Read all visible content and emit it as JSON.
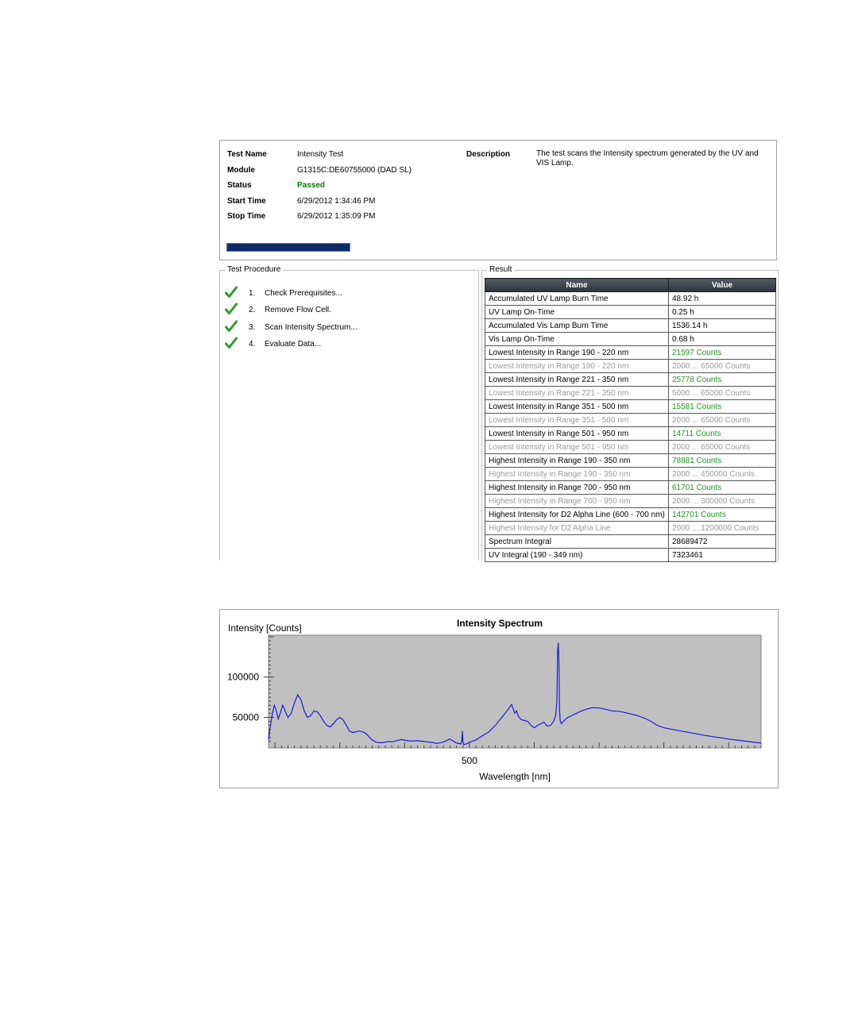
{
  "info": {
    "test_name_label": "Test Name",
    "test_name_value": "Intensity Test",
    "module_label": "Module",
    "module_value": "G1315C:DE60755000 (DAD SL)",
    "status_label": "Status",
    "status_value": "Passed",
    "start_label": "Start Time",
    "start_value": "6/29/2012 1:34:46 PM",
    "stop_label": "Stop Time",
    "stop_value": "6/29/2012 1:35:09 PM",
    "description_label": "Description",
    "description_value": "The test scans the Intensity spectrum generated by the UV and VIS Lamp.",
    "progress_percent": 100,
    "progress_color": "#0e2a6a"
  },
  "procedure": {
    "title": "Test Procedure",
    "steps": [
      {
        "num": "1.",
        "label": "Check Prerequisites...",
        "icon": "checkmark-icon"
      },
      {
        "num": "2.",
        "label": "Remove Flow Cell.",
        "icon": "checkmark-icon"
      },
      {
        "num": "3.",
        "label": "Scan Intensity Spectrum...",
        "icon": "checkmark-icon"
      },
      {
        "num": "4.",
        "label": "Evaluate Data...",
        "icon": "checkmark-icon"
      }
    ]
  },
  "result": {
    "title": "Result",
    "col_name": "Name",
    "col_value": "Value",
    "rows": [
      {
        "name": "Accumulated UV Lamp Burn Time",
        "value": "48.92 h",
        "type": "normal"
      },
      {
        "name": "UV Lamp On-Time",
        "value": "0.25 h",
        "type": "normal"
      },
      {
        "name": "Accumulated Vis Lamp Burn Time",
        "value": "1536.14 h",
        "type": "normal"
      },
      {
        "name": "Vis Lamp On-Time",
        "value": "0.68 h",
        "type": "normal"
      },
      {
        "name": "Lowest Intensity in Range 190 - 220 nm",
        "value": "21597 Counts",
        "type": "green"
      },
      {
        "name": "Lowest Intensity in Range 190 - 220 nm",
        "value": "2000 ... 65000 Counts",
        "type": "sub"
      },
      {
        "name": "Lowest Intensity in Range 221 - 350 nm",
        "value": "25778 Counts",
        "type": "green"
      },
      {
        "name": "Lowest Intensity in Range 221 - 350 nm",
        "value": "5000 ... 65000 Counts",
        "type": "sub"
      },
      {
        "name": "Lowest Intensity in Range 351 - 500 nm",
        "value": "15581 Counts",
        "type": "green"
      },
      {
        "name": "Lowest Intensity in Range 351 - 500 nm",
        "value": "2000 ... 65000 Counts",
        "type": "sub"
      },
      {
        "name": "Lowest Intensity in Range 501 - 950 nm",
        "value": "14711 Counts",
        "type": "green"
      },
      {
        "name": "Lowest Intensity in Range 501 - 950 nm",
        "value": "2000 ... 65000 Counts",
        "type": "sub"
      },
      {
        "name": "Highest Intensity in Range 190 - 350 nm",
        "value": "78881 Counts",
        "type": "green"
      },
      {
        "name": "Highest Intensity in Range 190 - 350 nm",
        "value": "2000 ... 450000 Counts",
        "type": "sub"
      },
      {
        "name": "Highest Intensity in Range 700 - 950 nm",
        "value": "61701 Counts",
        "type": "green"
      },
      {
        "name": "Highest Intensity in Range 700 - 950 nm",
        "value": "2000 ... 300000 Counts",
        "type": "sub"
      },
      {
        "name": "Highest Intensity for D2 Alpha Line (600 - 700 nm)",
        "value": "142701 Counts",
        "type": "green"
      },
      {
        "name": "Highest Intensity for D2 Alpha Line",
        "value": "2000 ... 1200000 Counts",
        "type": "sub"
      },
      {
        "name": "Spectrum Integral",
        "value": "28689472",
        "type": "normal"
      },
      {
        "name": "UV Integral (190 - 349 nm)",
        "value": "7323461",
        "type": "normal"
      }
    ]
  },
  "chart_data": {
    "type": "line",
    "title": "Intensity Spectrum",
    "xlabel": "Wavelength [nm]",
    "ylabel": "Intensity [Counts]",
    "xlim": [
      190,
      950
    ],
    "ylim": [
      12000,
      152000
    ],
    "xticks": [
      500
    ],
    "yticks": [
      50000,
      100000
    ],
    "grid": false,
    "background": "#c0c0c0",
    "line_color": "#1a1ae6",
    "series": [
      {
        "x": [
          190,
          193,
          196,
          199,
          202,
          205,
          208,
          212,
          216,
          220,
          225,
          230,
          235,
          240,
          245,
          250,
          255,
          260,
          265,
          270,
          275,
          280,
          285,
          290,
          295,
          300,
          305,
          310,
          315,
          320,
          325,
          330,
          335,
          340,
          345,
          350,
          355,
          360,
          365,
          370,
          375,
          380,
          385,
          390,
          395,
          400,
          410,
          420,
          430,
          440,
          450,
          460,
          470,
          480,
          487,
          488,
          489,
          490,
          491,
          495,
          500,
          510,
          520,
          530,
          540,
          550,
          560,
          565,
          570,
          573,
          575,
          577,
          580,
          585,
          590,
          595,
          600,
          605,
          610,
          615,
          620,
          625,
          630,
          633,
          635,
          636,
          637,
          638,
          639,
          640,
          642,
          645,
          650,
          660,
          670,
          680,
          690,
          700,
          710,
          720,
          730,
          740,
          750,
          760,
          770,
          780,
          790,
          800,
          820,
          840,
          860,
          880,
          900,
          920,
          940,
          950
        ],
        "y": [
          22000,
          40000,
          55000,
          65000,
          58000,
          48000,
          55000,
          65000,
          57000,
          50000,
          55000,
          68000,
          78000,
          72000,
          58000,
          50000,
          52000,
          58000,
          57000,
          52000,
          45000,
          40000,
          38000,
          42000,
          47000,
          50000,
          47000,
          40000,
          33000,
          31000,
          32000,
          33000,
          32000,
          30000,
          26000,
          22000,
          19500,
          18500,
          18500,
          19000,
          20000,
          19500,
          20500,
          21500,
          22500,
          21500,
          20500,
          21000,
          20000,
          19000,
          17500,
          19500,
          23000,
          18000,
          17000,
          20000,
          33000,
          20000,
          16000,
          17000,
          19000,
          22000,
          27000,
          32000,
          40000,
          50000,
          60000,
          66000,
          55000,
          58000,
          52000,
          50000,
          47000,
          46000,
          45000,
          40000,
          37000,
          40000,
          42000,
          44000,
          39000,
          40000,
          45000,
          52000,
          70000,
          130000,
          142700,
          120000,
          60000,
          46000,
          42000,
          45000,
          49000,
          53000,
          57000,
          60000,
          62000,
          61701,
          60000,
          58000,
          57500,
          56000,
          54000,
          52000,
          49000,
          45000,
          40000,
          37000,
          34000,
          31000,
          28000,
          25500,
          23000,
          21000,
          19000,
          18000
        ]
      }
    ]
  }
}
